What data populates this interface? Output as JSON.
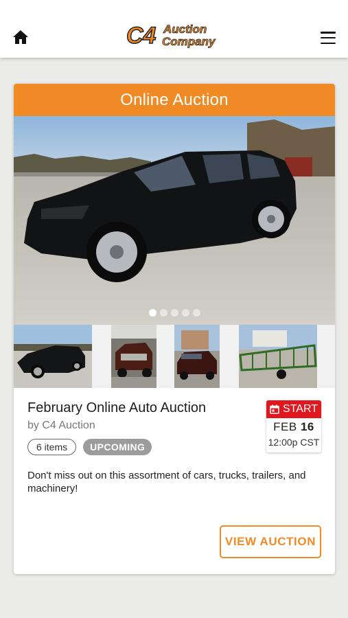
{
  "header": {
    "logo_text_big": "C4",
    "logo_text_line1": "Auction",
    "logo_text_line2": "Company"
  },
  "card": {
    "banner": "Online Auction",
    "carousel": {
      "slide_count": 5,
      "active_index": 0
    },
    "title": "February Online Auto Auction",
    "byline": "by C4 Auction",
    "items_badge": "6 items",
    "status_badge": "UPCOMING",
    "date": {
      "label": "START",
      "month": "FEB",
      "day": "16",
      "time": "12:00p CST"
    },
    "description": "Don't miss out on this assortment of cars, trucks, trailers, and machinery!",
    "view_button": "VIEW AUCTION"
  },
  "colors": {
    "brand_orange": "#f08a24",
    "date_red": "#e0171e",
    "badge_gray": "#9c9c9c",
    "page_bg": "#ebebe9"
  }
}
